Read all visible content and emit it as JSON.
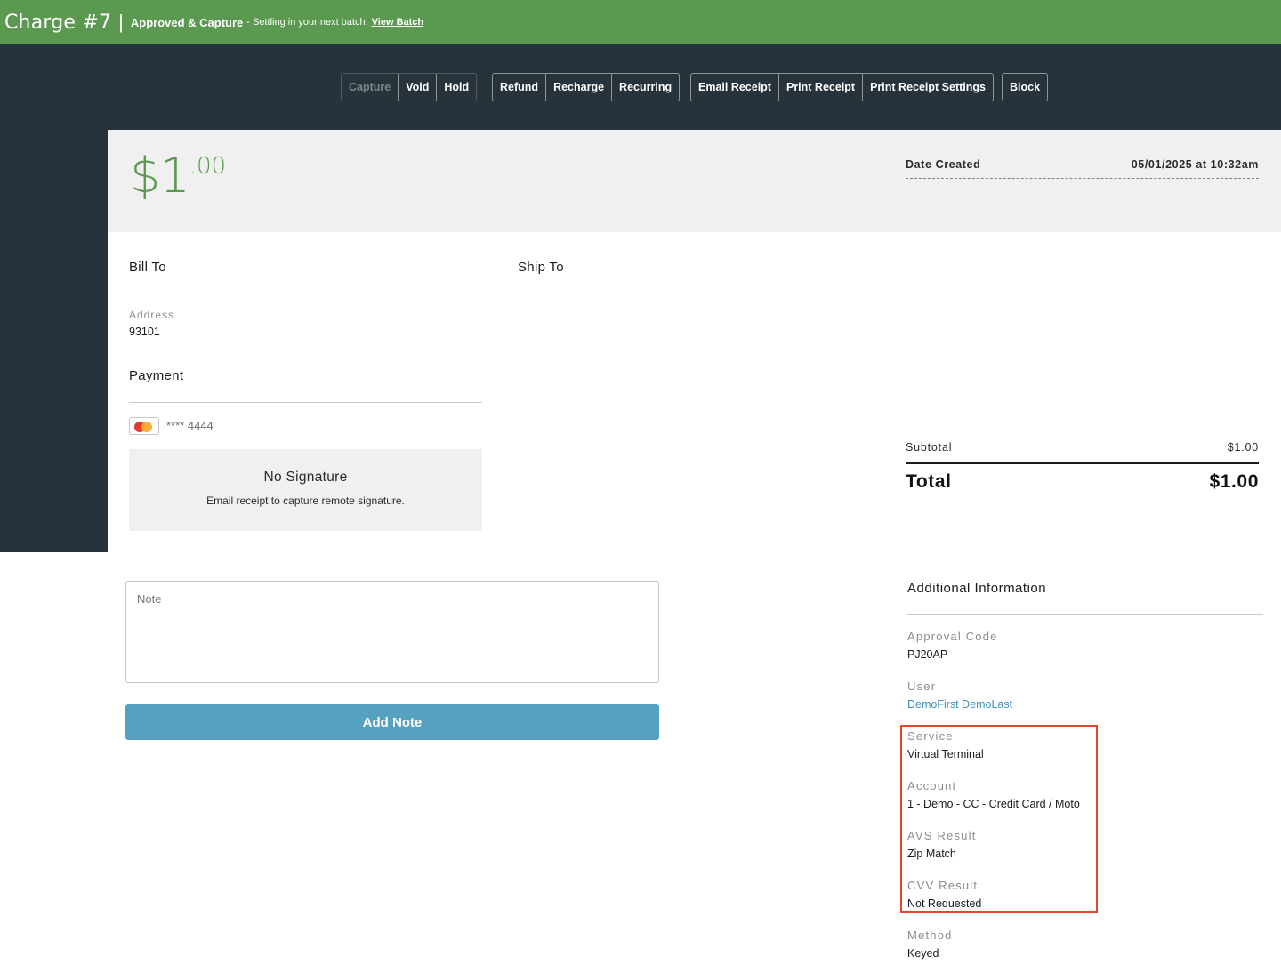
{
  "header": {
    "charge_title": "Charge #7",
    "separator": "|",
    "status": "Approved & Capture",
    "status_detail": "- Settling in your next batch.",
    "view_batch_link": "View Batch",
    "bar_color": "#5b9850"
  },
  "toolbar": {
    "group1": [
      "Capture",
      "Void",
      "Hold"
    ],
    "group2": [
      "Refund",
      "Recharge",
      "Recurring"
    ],
    "group3": [
      "Email Receipt",
      "Print Receipt",
      "Print Receipt Settings"
    ],
    "group4": [
      "Block"
    ],
    "disabled": [
      "Capture"
    ]
  },
  "summary": {
    "amount_dollars": "$1",
    "amount_cents": ".00",
    "date_label": "Date Created",
    "date_value": "05/01/2025 at 10:32am"
  },
  "bill_to": {
    "title": "Bill To",
    "address_label": "Address",
    "address_value": "93101"
  },
  "ship_to": {
    "title": "Ship To"
  },
  "payment": {
    "title": "Payment",
    "card_icon": "mastercard-icon",
    "card_number": "**** 4444",
    "signature_title": "No Signature",
    "signature_hint": "Email receipt to capture remote signature."
  },
  "totals": {
    "subtotal_label": "Subtotal",
    "subtotal_value": "$1.00",
    "total_label": "Total",
    "total_value": "$1.00"
  },
  "note": {
    "placeholder": "Note",
    "button_label": "Add Note"
  },
  "additional_info": {
    "title": "Additional Information",
    "approval_code_label": "Approval Code",
    "approval_code_value": "PJ20AP",
    "user_label": "User",
    "user_value": "DemoFirst DemoLast",
    "service_label": "Service",
    "service_value": "Virtual Terminal",
    "account_label": "Account",
    "account_value": "1 - Demo - CC - Credit Card / Moto",
    "avs_label": "AVS Result",
    "avs_value": "Zip Match",
    "cvv_label": "CVV Result",
    "cvv_value": "Not Requested",
    "method_label": "Method",
    "method_value": "Keyed",
    "highlight_color": "#e0462a"
  }
}
